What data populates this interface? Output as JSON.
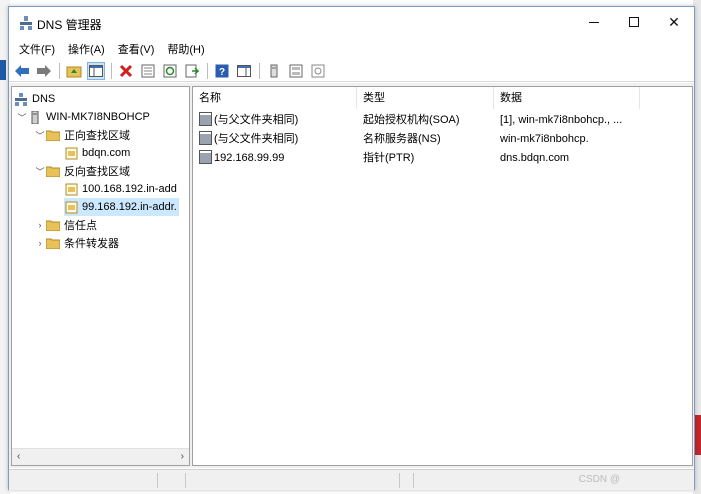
{
  "window": {
    "title": "DNS 管理器",
    "minimize_icon": "minimize-icon",
    "maximize_icon": "maximize-icon",
    "close_label": "✕"
  },
  "menu": [
    "文件(F)",
    "操作(A)",
    "查看(V)",
    "帮助(H)"
  ],
  "toolbar": {
    "icons": [
      "back-arrow-icon",
      "forward-arrow-icon",
      "up-folder-icon",
      "show-hide-console-tree-icon",
      "delete-icon",
      "properties-icon",
      "refresh-icon",
      "export-list-icon",
      "help-icon",
      "action-pane-icon",
      "new-host-icon",
      "new-alias-icon",
      "new-mail-exchanger-icon"
    ]
  },
  "tree": {
    "root": "DNS",
    "server": "WIN-MK7I8NBOHCP",
    "forward_zone": "正向查找区域",
    "forward_child": "bdqn.com",
    "reverse_zone": "反向查找区域",
    "reverse_child_1": "100.168.192.in-add",
    "reverse_child_2": "99.168.192.in-addr.",
    "trust_points": "信任点",
    "conditional_forwarders": "条件转发器"
  },
  "list": {
    "columns": [
      "名称",
      "类型",
      "数据"
    ],
    "rows": [
      {
        "name": "(与父文件夹相同)",
        "type": "起始授权机构(SOA)",
        "data": "[1], win-mk7i8nbohcp., ..."
      },
      {
        "name": "(与父文件夹相同)",
        "type": "名称服务器(NS)",
        "data": "win-mk7i8nbohcp."
      },
      {
        "name": "192.168.99.99",
        "type": "指针(PTR)",
        "data": "dns.bdqn.com"
      }
    ]
  },
  "status": {
    "watermark": "CSDN @"
  },
  "colors": {
    "selection": "#cce8ff",
    "folder": "#e8c15a",
    "delete_red": "#d11f1f",
    "help_blue": "#2a5db0"
  }
}
